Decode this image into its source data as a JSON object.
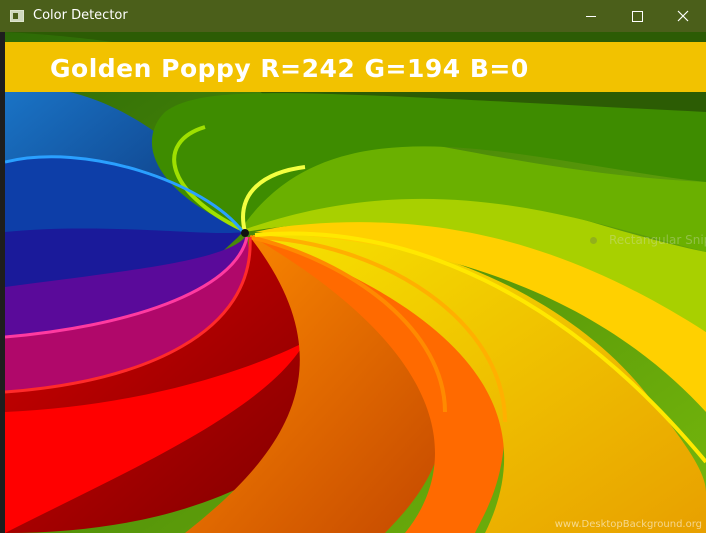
{
  "window": {
    "title": "Color Detector",
    "controls": {
      "minimize": "minimize",
      "maximize": "maximize",
      "close": "close"
    }
  },
  "detector": {
    "label": "Golden Poppy R=242 G=194 B=0",
    "color_name": "Golden Poppy",
    "rgb": {
      "r": 242,
      "g": 194,
      "b": 0
    },
    "banner_color": "#f2c200"
  },
  "background_ghost": {
    "label": "Rectangular Snip"
  },
  "image": {
    "watermark": "www.DesktopBackground.org"
  },
  "colors": {
    "titlebar": "#4b5f1a",
    "banner": "#f2c200",
    "banner_text": "#ffffff"
  }
}
